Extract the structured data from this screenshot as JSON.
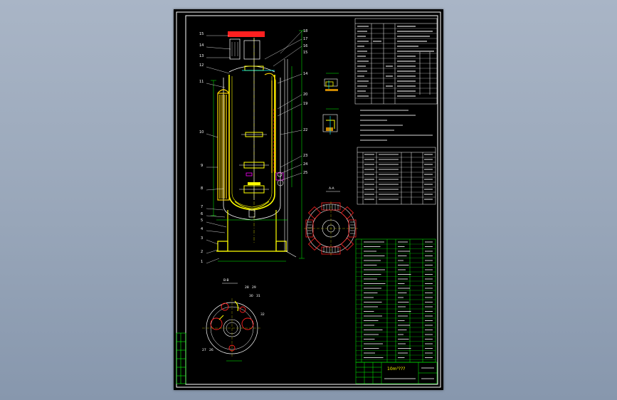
{
  "drawing": {
    "title_block_text": "10m³???",
    "section_label_top": "A-A",
    "section_label_bottom": "B-B"
  },
  "callouts": {
    "left_upper": [
      "15",
      "14",
      "13",
      "12",
      "11",
      "10",
      "9",
      "8"
    ],
    "left_lower": [
      "7",
      "6",
      "5",
      "4",
      "3",
      "2",
      "1"
    ],
    "right_upper": [
      "18",
      "17",
      "16",
      "15",
      "14",
      "20",
      "19",
      "22"
    ],
    "right_lower": [
      "23",
      "24",
      "25"
    ],
    "plan_view": [
      "28",
      "29",
      "30",
      "31",
      "32",
      "27",
      "26"
    ]
  },
  "colors": {
    "sheet": "#000000",
    "frame": "#ffffff",
    "vessel": "#ffff00",
    "jacket": "#ffd700",
    "dimension": "#00ff00",
    "red": "#ff2020",
    "cyan": "#00ffff",
    "magenta": "#ff00ff"
  }
}
